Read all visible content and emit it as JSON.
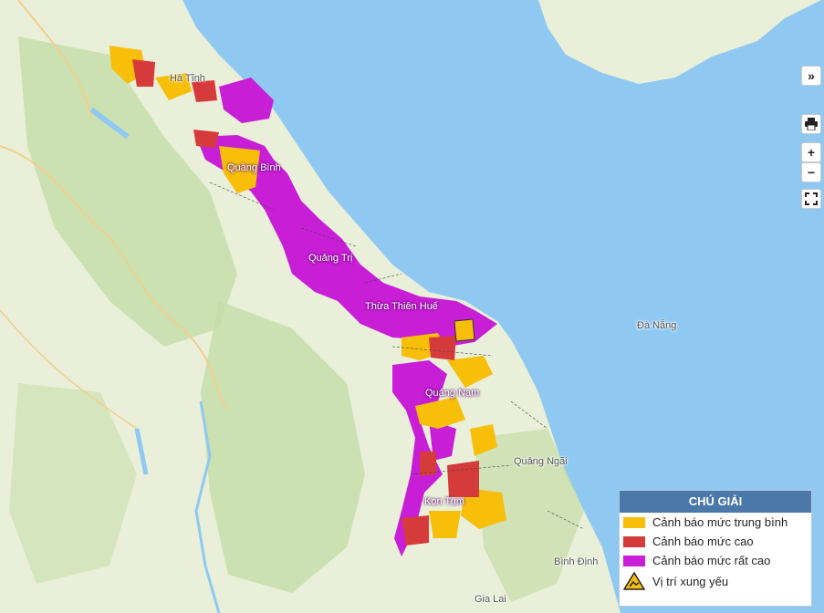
{
  "map": {
    "places": {
      "ha_tinh": "Hà Tĩnh",
      "quang_binh": "Quảng Bình",
      "quang_tri": "Quảng Trị",
      "thua_thien_hue": "Thừa Thiên Huế",
      "da_nang": "Đà Nẵng",
      "quang_nam": "Quảng Nam",
      "quang_ngai": "Quảng Ngãi",
      "kon_tum": "Kon Tum",
      "binh_dinh": "Bình Định",
      "gia_lai": "Gia Lai"
    },
    "colors": {
      "sea": "#8fc9f2",
      "land": "#e9efd8",
      "forest": "#c4dda8",
      "medium": "#f7be0a",
      "high": "#d63b3b",
      "very_high": "#c81ed6"
    }
  },
  "controls": {
    "expand": "»",
    "print_icon": "printer-icon",
    "zoom_in": "+",
    "zoom_out": "−",
    "fullscreen_icon": "fullscreen-icon"
  },
  "legend": {
    "title": "CHÚ GIẢI",
    "items": [
      {
        "label": "Cảnh báo mức trung bình",
        "color": "#f7be0a"
      },
      {
        "label": "Cảnh báo mức cao",
        "color": "#d63b3b"
      },
      {
        "label": "Cảnh báo mức rất cao",
        "color": "#c81ed6"
      },
      {
        "label": "Vị trí xung yếu",
        "icon": "landslide-warning-icon"
      }
    ]
  }
}
